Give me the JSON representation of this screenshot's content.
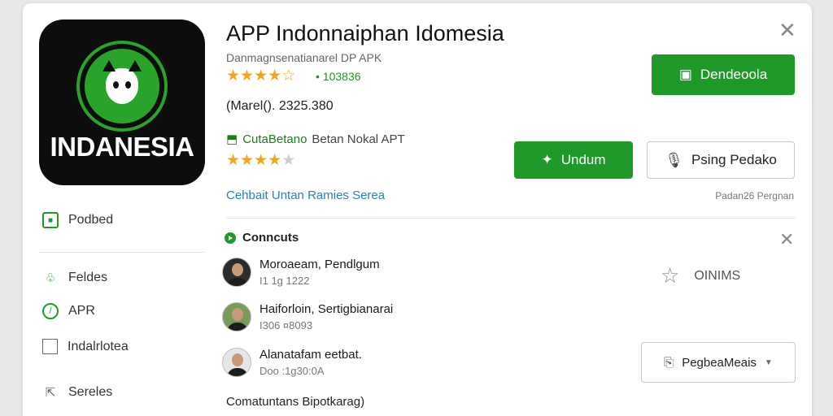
{
  "app": {
    "icon_name": "app-logo",
    "icon_text": "INDANESIA",
    "title": "APP Indonnaiphan Idomesia",
    "subtitle": "Danmagnsenatianarel DP APK",
    "rating_count": "103836",
    "rating_stars": 4.5,
    "size_line": "(Marel(). 2325.380",
    "category_green": "CutaBetano",
    "category_gray": "Betan Nokal APT",
    "rating_stars_2": 4,
    "link": "Cehbait Untan Ramies Serea",
    "small_note": "Padan26 Pergnan"
  },
  "buttons": {
    "download": "Dendeoola",
    "unduh": "Undum",
    "pesan": "Psing Pedako",
    "more": "PegbeaMeais"
  },
  "sidebar": {
    "items": [
      {
        "label": "Podbed",
        "icon": "box-icon"
      },
      {
        "label": "Feldes",
        "icon": "leaf-icon"
      },
      {
        "label": "APR",
        "icon": "clock-icon"
      },
      {
        "label": "Indalrlotea",
        "icon": "checkbox-icon"
      },
      {
        "label": "Sereles",
        "icon": "share-icon"
      }
    ]
  },
  "comments": {
    "header": "Conncuts",
    "favorite_label": "OINIMS",
    "items": [
      {
        "name": "Moroaeam, Pendlgum",
        "meta": "I1 1g 1222"
      },
      {
        "name": "Haiforloin,  Sertigbianarai",
        "meta": "I306 ¤8093"
      },
      {
        "name": "Alanatafam eetbat.",
        "meta": "Doo :1g30:0A"
      }
    ],
    "footer": "Comatuntans Bipotkarag)"
  },
  "colors": {
    "accent": "#1f9a2a",
    "star": "#f2a61b",
    "link": "#2a7fc4"
  }
}
